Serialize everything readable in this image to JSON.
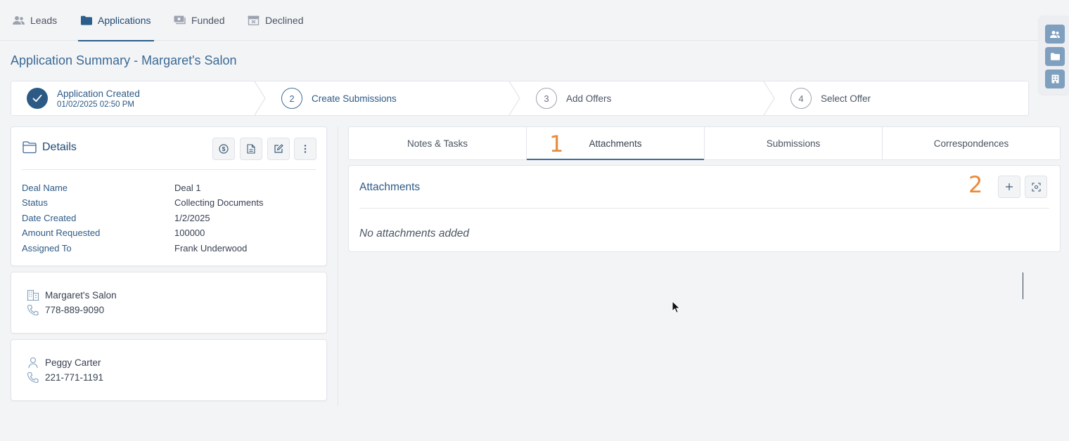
{
  "nav": {
    "tabs": [
      {
        "label": "Leads",
        "icon": "users-icon"
      },
      {
        "label": "Applications",
        "icon": "folder-icon",
        "active": true
      },
      {
        "label": "Funded",
        "icon": "money-icon"
      },
      {
        "label": "Declined",
        "icon": "archive-x-icon"
      }
    ]
  },
  "rail": {
    "icons": [
      "users-icon",
      "folder-icon",
      "building-icon"
    ]
  },
  "page": {
    "title": "Application Summary - Margaret's Salon"
  },
  "stepper": {
    "steps": [
      {
        "number": "✓",
        "title": "Application Created",
        "subtitle": "01/02/2025 02:50 PM",
        "state": "done"
      },
      {
        "number": "2",
        "title": "Create Submissions",
        "state": "current"
      },
      {
        "number": "3",
        "title": "Add Offers",
        "state": "upcoming"
      },
      {
        "number": "4",
        "title": "Select Offer",
        "state": "upcoming"
      }
    ]
  },
  "details": {
    "title": "Details",
    "actions": [
      "dollar-icon",
      "document-icon",
      "edit-icon",
      "more-vertical-icon"
    ],
    "fields": [
      {
        "label": "Deal Name",
        "value": "Deal 1"
      },
      {
        "label": "Status",
        "value": "Collecting Documents"
      },
      {
        "label": "Date Created",
        "value": "1/2/2025"
      },
      {
        "label": "Amount Requested",
        "value": "100000"
      },
      {
        "label": "Assigned To",
        "value": "Frank Underwood"
      }
    ]
  },
  "business": {
    "name": "Margaret's Salon",
    "phone": "778-889-9090"
  },
  "contact": {
    "name": "Peggy Carter",
    "phone": "221-771-1191"
  },
  "tabs": {
    "items": [
      "Notes & Tasks",
      "Attachments",
      "Submissions",
      "Correspondences"
    ],
    "active": "Attachments"
  },
  "annotations": {
    "one": "1",
    "two": "2"
  },
  "attachments": {
    "title": "Attachments",
    "empty": "No attachments added",
    "actions": [
      "plus-icon",
      "scan-icon"
    ]
  },
  "colors": {
    "primary": "#2d5a85",
    "accent": "#e98a3a",
    "background": "#f3f4f6"
  }
}
